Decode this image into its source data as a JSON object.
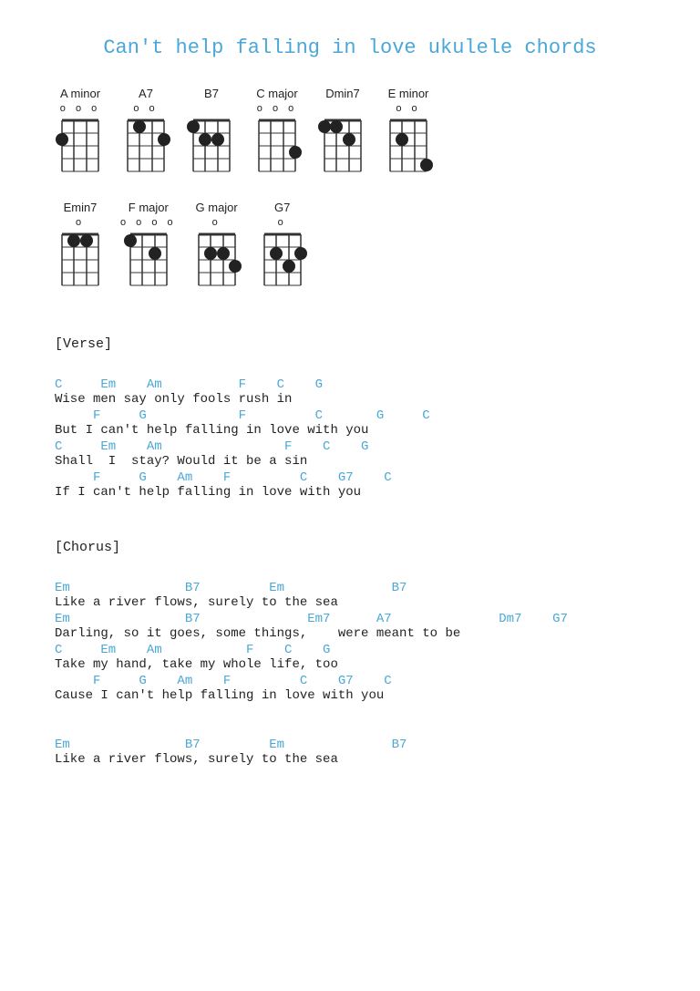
{
  "title": "Can't help falling in love ukulele chords",
  "chords": [
    {
      "name": "A minor",
      "open": "o  o  o",
      "dots": [
        [
          1,
          0,
          0
        ],
        [
          0,
          3,
          0
        ],
        [
          0,
          0,
          0
        ],
        [
          0,
          0,
          0
        ]
      ]
    },
    {
      "name": "A7",
      "open": "o  o",
      "dots": [
        [
          0,
          1,
          0
        ],
        [
          0,
          0,
          3
        ],
        [
          0,
          0,
          0
        ],
        [
          0,
          0,
          0
        ]
      ]
    },
    {
      "name": "B7",
      "open": "",
      "dots": [
        [
          1,
          0,
          0
        ],
        [
          0,
          2,
          3
        ],
        [
          0,
          0,
          0
        ],
        [
          0,
          0,
          0
        ]
      ]
    },
    {
      "name": "C major",
      "open": "o  o  o",
      "dots": [
        [
          0,
          0,
          0
        ],
        [
          0,
          0,
          0
        ],
        [
          0,
          0,
          3
        ],
        [
          0,
          0,
          0
        ]
      ]
    },
    {
      "name": "Dmin7",
      "open": "",
      "dots": [
        [
          1,
          1,
          0
        ],
        [
          0,
          2,
          0
        ],
        [
          0,
          0,
          0
        ],
        [
          0,
          0,
          0
        ]
      ]
    },
    {
      "name": "E minor",
      "open": "o  o",
      "dots": [
        [
          0,
          0,
          0
        ],
        [
          0,
          3,
          0
        ],
        [
          0,
          0,
          0
        ],
        [
          2,
          0,
          0
        ]
      ]
    },
    {
      "name": "Emin7",
      "open": "o",
      "dots": [
        [
          0,
          1,
          2
        ],
        [
          0,
          0,
          0
        ],
        [
          0,
          0,
          0
        ],
        [
          0,
          0,
          0
        ]
      ]
    },
    {
      "name": "F major",
      "open": "o  o  o  o",
      "dots": [
        [
          1,
          0,
          0
        ],
        [
          0,
          2,
          0
        ],
        [
          0,
          0,
          0
        ],
        [
          0,
          0,
          0
        ]
      ]
    },
    {
      "name": "G major",
      "open": "o",
      "dots": [
        [
          0,
          1,
          3
        ],
        [
          0,
          0,
          2
        ],
        [
          0,
          0,
          0
        ],
        [
          0,
          0,
          0
        ]
      ]
    },
    {
      "name": "G7",
      "open": "o",
      "dots": [
        [
          0,
          0,
          2
        ],
        [
          0,
          1,
          3
        ],
        [
          0,
          0,
          0
        ],
        [
          0,
          0,
          0
        ]
      ]
    }
  ],
  "sections": [
    {
      "label": "[Verse]",
      "lines": [
        {
          "chords": "C     Em    Am          F    C    G",
          "lyrics": "Wise men say only fools rush in"
        },
        {
          "chords": "     F     G            F         C       G     C",
          "lyrics": "But I can't help falling in love with you"
        },
        {
          "chords": "C     Em    Am                F    C    G",
          "lyrics": "Shall  I  stay? Would it be a sin"
        },
        {
          "chords": "     F     G    Am    F         C    G7    C",
          "lyrics": "If I can't help falling in love with you"
        }
      ]
    },
    {
      "label": "[Chorus]",
      "lines": [
        {
          "chords": "Em               B7         Em              B7",
          "lyrics": "Like a river flows, surely to the sea"
        },
        {
          "chords": "Em               B7              Em7      A7              Dm7    G7",
          "lyrics": "Darling, so it goes, some things,    were meant to be"
        },
        {
          "chords": "C     Em    Am           F    C    G",
          "lyrics": "Take my hand, take my whole life, too"
        },
        {
          "chords": "     F     G    Am    F         C    G7    C",
          "lyrics": "Cause I can't help falling in love with you"
        }
      ]
    },
    {
      "label": "",
      "lines": [
        {
          "chords": "Em               B7         Em              B7",
          "lyrics": "Like a river flows, surely to the sea"
        }
      ]
    }
  ]
}
